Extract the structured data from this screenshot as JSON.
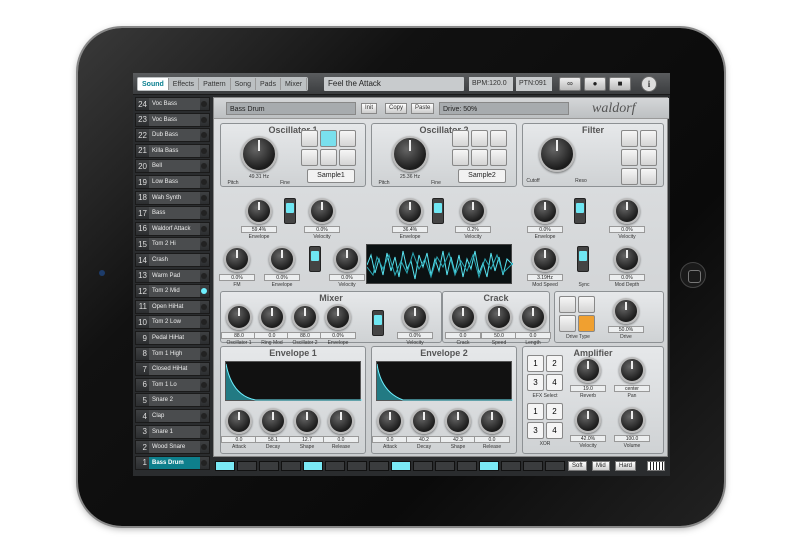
{
  "topbar": {
    "tabs": [
      "Sound",
      "Effects",
      "Pattern",
      "Song",
      "Pads",
      "Mixer"
    ],
    "song": "Feel the Attack",
    "bpm": "BPM:120.0",
    "ptn": "PTN:091",
    "info": "i"
  },
  "tracks": [
    {
      "n": "24",
      "name": "Voc Bass"
    },
    {
      "n": "23",
      "name": "Voc Bass"
    },
    {
      "n": "22",
      "name": "Dub Bass"
    },
    {
      "n": "21",
      "name": "Killa Bass"
    },
    {
      "n": "20",
      "name": "Bell"
    },
    {
      "n": "19",
      "name": "Low Bass"
    },
    {
      "n": "18",
      "name": "Wah Synth"
    },
    {
      "n": "17",
      "name": "Bass"
    },
    {
      "n": "16",
      "name": "Waldorf Attack"
    },
    {
      "n": "15",
      "name": "Tom 2 Hi"
    },
    {
      "n": "14",
      "name": "Crash"
    },
    {
      "n": "13",
      "name": "Warm Pad"
    },
    {
      "n": "12",
      "name": "Tom 2 Mid"
    },
    {
      "n": "11",
      "name": "Open HiHat"
    },
    {
      "n": "10",
      "name": "Tom 2 Low"
    },
    {
      "n": "9",
      "name": "Pedal HiHat"
    },
    {
      "n": "8",
      "name": "Tom 1 High"
    },
    {
      "n": "7",
      "name": "Closed HiHat"
    },
    {
      "n": "6",
      "name": "Tom 1 Lo"
    },
    {
      "n": "5",
      "name": "Snare 2"
    },
    {
      "n": "4",
      "name": "Clap"
    },
    {
      "n": "3",
      "name": "Snare 1"
    },
    {
      "n": "2",
      "name": "Wood Snare"
    },
    {
      "n": "1",
      "name": "Bass Drum"
    }
  ],
  "panel": {
    "instrument": "Bass Drum",
    "init": "Init",
    "copy": "Copy",
    "paste": "Paste",
    "drive": "Drive: 50%",
    "logo": "waldorf"
  },
  "osc1": {
    "title": "Oscillator 1",
    "sample": "Sample1",
    "pitch_val": "49.31 Hz",
    "pitch": "Pitch",
    "fine": "Fine",
    "env_val": "59.4%",
    "env": "Envelope",
    "vel_val": "0.0%",
    "vel": "Velocity"
  },
  "osc2": {
    "title": "Oscillator 2",
    "sample": "Sample2",
    "pitch_val": "25.36 Hz",
    "pitch": "Pitch",
    "fine": "Fine",
    "env_val": "36.4%",
    "env": "Envelope",
    "vel_val": "0.2%",
    "vel": "Velocity"
  },
  "filter": {
    "title": "Filter",
    "cutoff": "Cutoff",
    "reso": "Reso",
    "env_val": "0.0%",
    "env": "Envelope",
    "vel_val": "0.0%",
    "vel": "Velocity",
    "modspeed_val": "3.19Hz",
    "modspeed": "Mod Speed",
    "sync": "Sync",
    "moddepth_val": "0.0%",
    "moddepth": "Mod Depth"
  },
  "fm": {
    "fm_val": "0.0%",
    "fm": "FM",
    "env_val": "0.0%",
    "env": "Envelope",
    "vel_val": "0.0%",
    "vel": "Velocity"
  },
  "mixer": {
    "title": "Mixer",
    "k": [
      {
        "v": "88.0",
        "l": "Oscillator 1"
      },
      {
        "v": "0.0",
        "l": "Ring Mod"
      },
      {
        "v": "88.0",
        "l": "Oscillator 2"
      },
      {
        "v": "0.0%",
        "l": "Envelope"
      },
      {
        "v": "0.0%",
        "l": "Velocity"
      }
    ]
  },
  "crack": {
    "title": "Crack",
    "k": [
      {
        "v": "0.0",
        "l": "Crack"
      },
      {
        "v": "50.0",
        "l": "Speed"
      },
      {
        "v": "0.0",
        "l": "Length"
      }
    ]
  },
  "drivetype": {
    "label": "Drive Type",
    "drive_val": "50.0%",
    "drive": "Drive"
  },
  "env1": {
    "title": "Envelope 1",
    "k": [
      {
        "v": "0.0",
        "l": "Attack"
      },
      {
        "v": "58.1",
        "l": "Decay"
      },
      {
        "v": "12.7",
        "l": "Shape"
      },
      {
        "v": "0.0",
        "l": "Release"
      }
    ]
  },
  "env2": {
    "title": "Envelope 2",
    "k": [
      {
        "v": "0.0",
        "l": "Attack"
      },
      {
        "v": "40.2",
        "l": "Decay"
      },
      {
        "v": "42.3",
        "l": "Shape"
      },
      {
        "v": "0.0",
        "l": "Release"
      }
    ]
  },
  "amp": {
    "title": "Amplifier",
    "efx": "EFX Select",
    "reverb_val": "19.0",
    "reverb": "Reverb",
    "pan_val": "center",
    "pan": "Pan",
    "xor": "XOR",
    "vel_val": "42.0%",
    "vel": "Velocity",
    "vol_val": "100.0",
    "vol": "Volume",
    "btns": [
      "1",
      "2",
      "3",
      "4"
    ]
  },
  "seq": {
    "soft": "Soft",
    "mid": "Mid",
    "hard": "Hard"
  },
  "colors": {
    "accent": "#79e0ee",
    "panel": "#d6d9db"
  }
}
